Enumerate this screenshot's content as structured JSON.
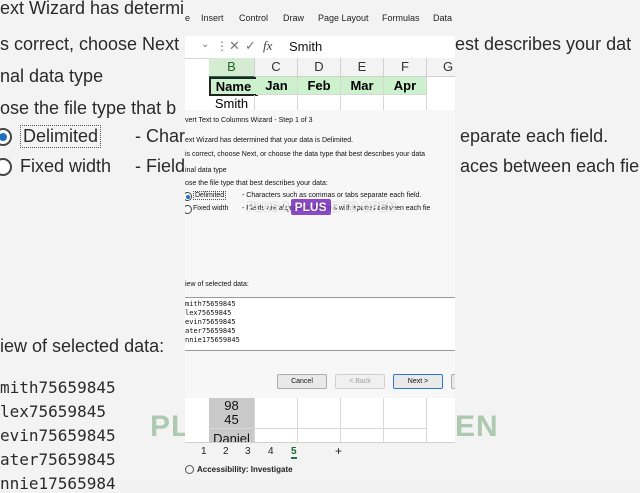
{
  "background": {
    "line1": "ext Wizard has determi",
    "line2": "s correct, choose Next",
    "line3": "nal data type",
    "line4": "ose the file type that b",
    "delimited": "Delimited",
    "delimited_desc": "- Chara",
    "delimited_desc_right": "eparate each field.",
    "fixed": "Fixed width",
    "fixed_desc": "- Field",
    "fixed_desc_right": "aces between each fie",
    "right_top": "est describes your dat",
    "preview_label": "iew of selected data:",
    "preview_rows": [
      "mith75659845",
      "lex75659845",
      "evin75659845",
      "ater75659845",
      "nnie17565984"
    ],
    "ghost_left": "PLU",
    "ghost_right": "EN"
  },
  "ribbon": {
    "tabs": [
      "e",
      "Insert",
      "Control",
      "Draw",
      "Page Layout",
      "Formulas",
      "Data"
    ]
  },
  "formula_bar": {
    "fx": "fx",
    "value": "Smith"
  },
  "grid": {
    "columns": [
      "B",
      "C",
      "D",
      "E",
      "F",
      "G"
    ],
    "header_row": [
      "Name",
      "Jan",
      "Feb",
      "Mar",
      "Apr"
    ],
    "row2": [
      "Smith"
    ]
  },
  "dialog": {
    "title": "vert Text to Columns Wizard - Step 1 of 3",
    "determined": "ext Wizard has determined that your data is Delimited.",
    "instruction": "is correct, choose Next, or choose the data type that best describes your data",
    "original_type": "inal data type",
    "choose": "ose the file type that best describes your data:",
    "delimited_label": "Delimited",
    "delimited_desc": "- Characters such as commas or tabs separate each field.",
    "fixed_label": "Fixed width",
    "fixed_desc": "- Fields are aligned in columns with spaces between each fie",
    "preview_label": "iew of selected data:",
    "preview_rows": [
      "mith75659845",
      "lex75659845",
      "evin75659845",
      "ater75659845",
      "nnie175659845"
    ],
    "buttons": {
      "cancel": "Cancel",
      "back": "< Back",
      "next": "Next >"
    }
  },
  "overlay": {
    "before": "PLUS A",
    "highlight": "PLUS",
    "after": "E TO OPEN"
  },
  "lower_grid": {
    "cell_line1": "98",
    "cell_line2": "45",
    "cell_cut": "Daniel"
  },
  "sheet_tabs": [
    "1",
    "2",
    "3",
    "4",
    "5"
  ],
  "status": {
    "accessibility": "Accessibility: Investigate"
  },
  "colors": {
    "accent": "#217346",
    "header_fill": "#cdf0cd",
    "overlay_highlight": "#7a2bbf"
  }
}
